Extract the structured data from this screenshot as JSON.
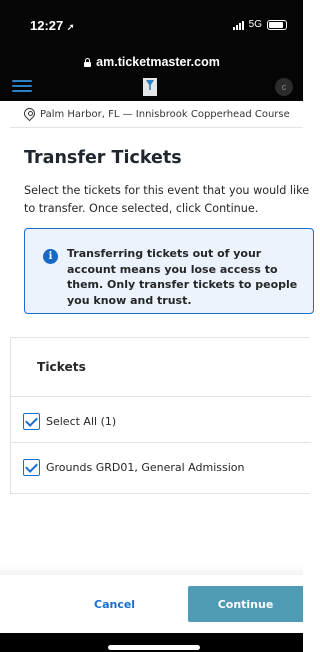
{
  "status_bar": {
    "time": "12:27",
    "network": "5G",
    "location_glyph": "➚"
  },
  "browser": {
    "url": "am.ticketmaster.com"
  },
  "header": {
    "avatar_initial": "c"
  },
  "event": {
    "location": "Palm Harbor, FL — Innisbrook Copperhead Course"
  },
  "page": {
    "title": "Transfer Tickets",
    "intro": "Select the tickets for this event that you would like to transfer. Once selected, click Continue.",
    "info_message": "Transferring tickets out of your account means you lose access to them. Only transfer tickets to people you know and trust.",
    "info_icon_glyph": "i"
  },
  "tickets": {
    "header": "Tickets",
    "select_all_label": "Select All (1)",
    "select_all_checked": true,
    "items": [
      {
        "label": "Grounds GRD01, General Admission",
        "checked": true
      }
    ]
  },
  "footer": {
    "cancel_label": "Cancel",
    "continue_label": "Continue"
  },
  "colors": {
    "accent": "#1a6ed0",
    "info_bg": "#ecf3fd",
    "continue_bg": "#4f9bb3",
    "header_bg": "#050505"
  }
}
